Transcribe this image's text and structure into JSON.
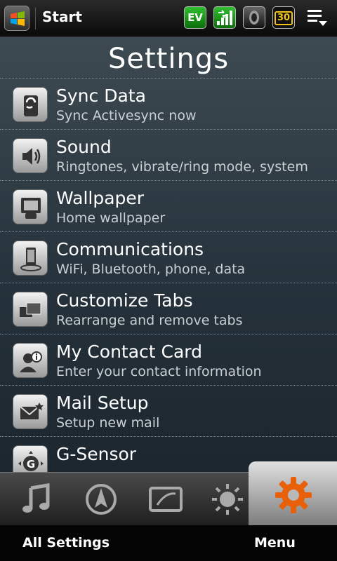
{
  "status_bar": {
    "title": "Start",
    "icons": [
      "windows-logo-icon",
      "ev-data-icon",
      "signal-icon",
      "volume-icon",
      "battery-icon",
      "notifications-menu-icon"
    ],
    "ev_label": "EV",
    "battery_label": "30"
  },
  "page": {
    "title": "Settings"
  },
  "settings": {
    "items": [
      {
        "name": "Sync Data",
        "desc": "Sync Activesync now",
        "icon": "sync-icon"
      },
      {
        "name": "Sound",
        "desc": "Ringtones, vibrate/ring mode, system",
        "icon": "speaker-icon"
      },
      {
        "name": "Wallpaper",
        "desc": "Home wallpaper",
        "icon": "wallpaper-icon"
      },
      {
        "name": "Communications",
        "desc": "WiFi, Bluetooth, phone, data",
        "icon": "phone-device-icon"
      },
      {
        "name": "Customize Tabs",
        "desc": "Rearrange and remove tabs",
        "icon": "tabs-icon"
      },
      {
        "name": "My Contact Card",
        "desc": "Enter your contact information",
        "icon": "contact-card-icon"
      },
      {
        "name": "Mail Setup",
        "desc": "Setup new mail",
        "icon": "mail-icon"
      },
      {
        "name": "G-Sensor",
        "desc": "",
        "icon": "g-sensor-icon"
      }
    ]
  },
  "tabs": [
    {
      "icon": "music-icon"
    },
    {
      "icon": "navigation-icon"
    },
    {
      "icon": "sprint-tv-icon"
    },
    {
      "icon": "weather-sun-icon"
    },
    {
      "icon": "settings-gear-icon",
      "active": true
    }
  ],
  "softkeys": {
    "left": "All Settings",
    "right": "Menu"
  }
}
